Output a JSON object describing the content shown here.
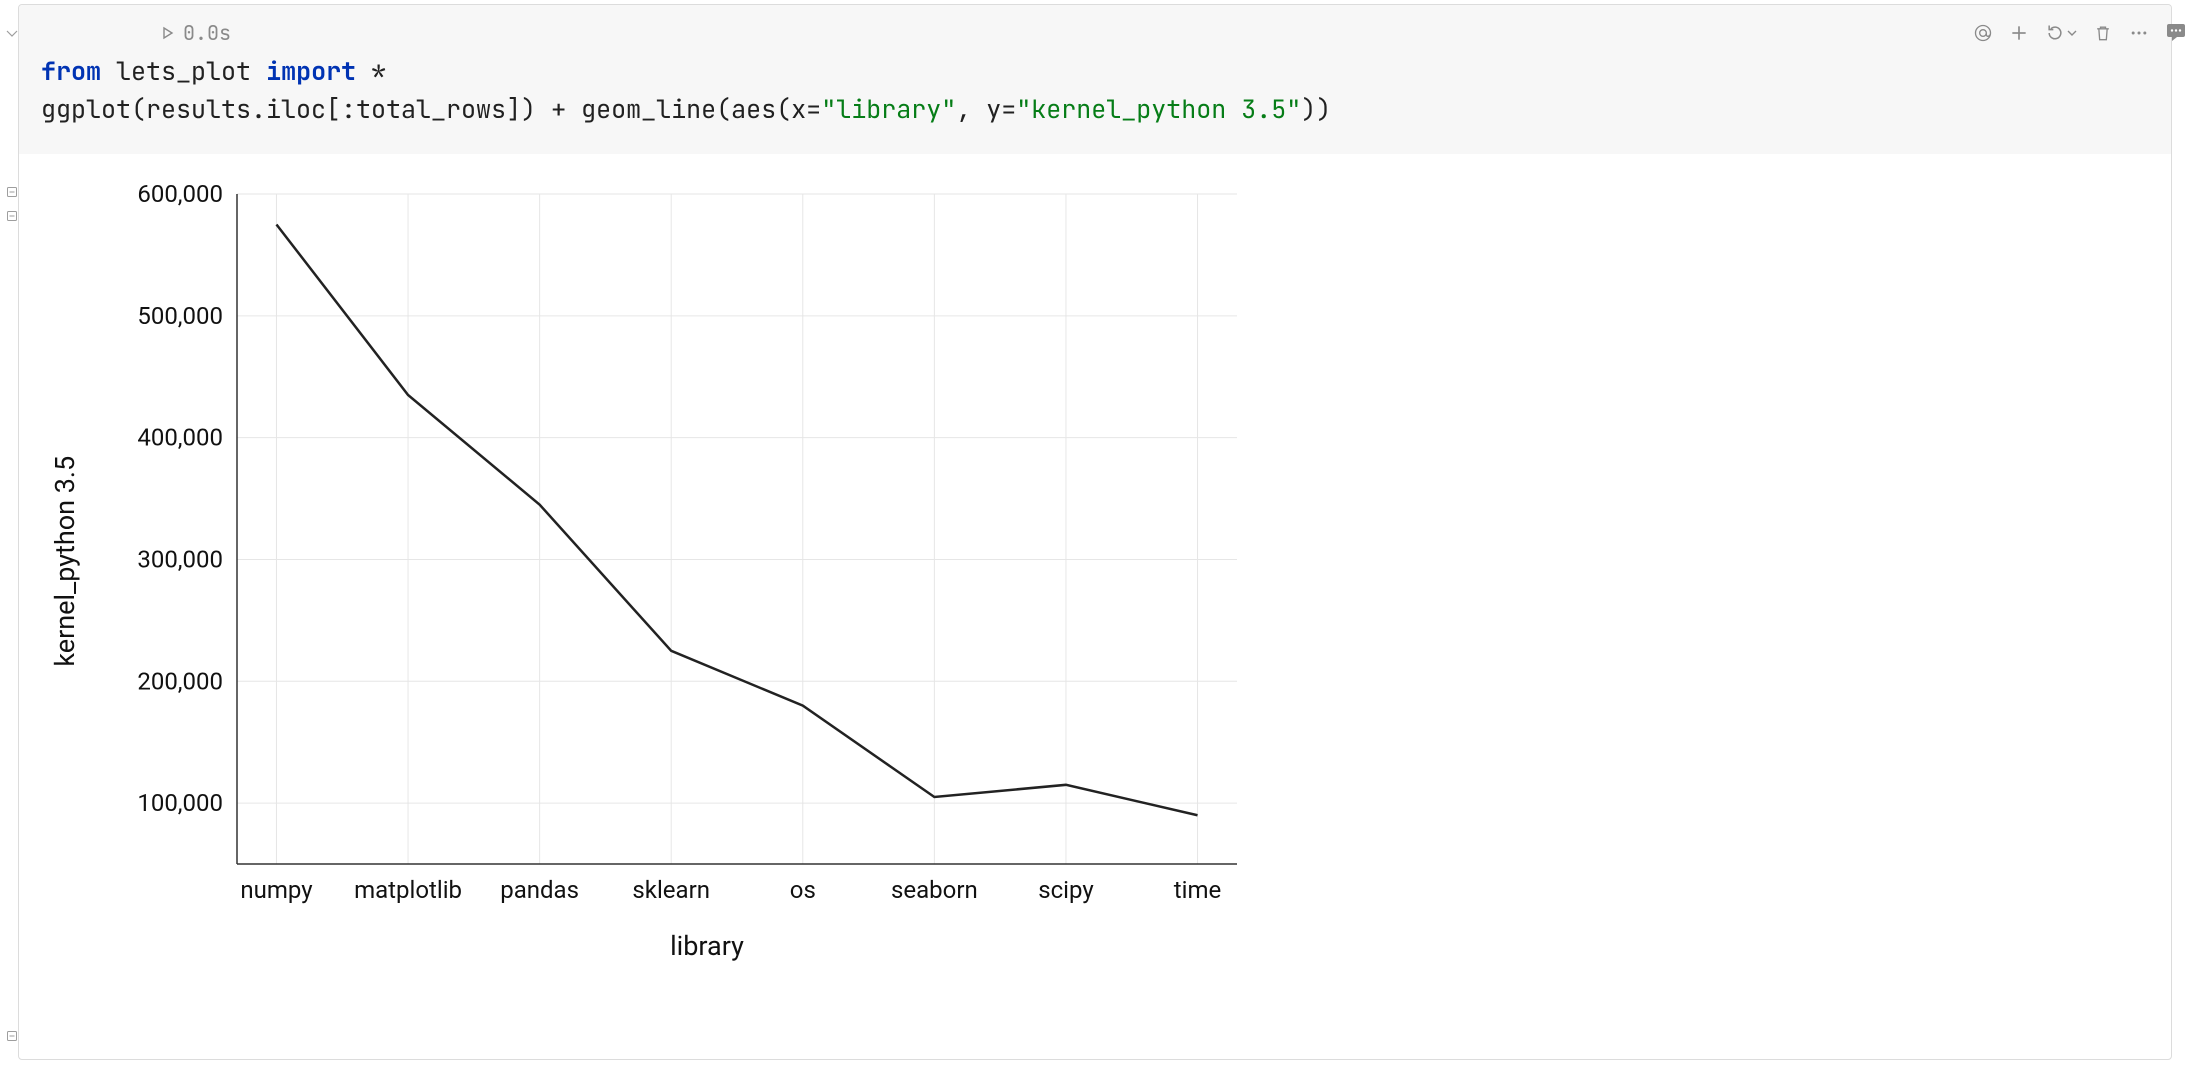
{
  "cell": {
    "run_time": "0.0s",
    "code": {
      "line1": {
        "kw1": "from",
        "mod": "lets_plot",
        "kw2": "import",
        "star": "*"
      },
      "line2": {
        "fn1": "ggplot",
        "arg1a": "results.iloc[:total_rows]",
        "plus": "+",
        "fn2": "geom_line",
        "fn3": "aes",
        "xparam": "x=",
        "xval": "\"library\"",
        "comma": ", ",
        "yparam": "y=",
        "yval": "\"kernel_python 3.5\""
      }
    }
  },
  "chart_data": {
    "type": "line",
    "categories": [
      "numpy",
      "matplotlib",
      "pandas",
      "sklearn",
      "os",
      "seaborn",
      "scipy",
      "time"
    ],
    "values": [
      575000,
      435000,
      345000,
      225000,
      180000,
      105000,
      115000,
      90000
    ],
    "xlabel": "library",
    "ylabel": "kernel_python 3.5",
    "ylim": [
      50000,
      600000
    ],
    "y_ticks": [
      100000,
      200000,
      300000,
      400000,
      500000,
      600000
    ],
    "y_tick_labels": [
      "100,000",
      "200,000",
      "300,000",
      "400,000",
      "500,000",
      "600,000"
    ]
  },
  "toolbar": {
    "icons": [
      "at-icon",
      "plus-icon",
      "restart-icon",
      "trash-icon",
      "more-icon"
    ]
  }
}
